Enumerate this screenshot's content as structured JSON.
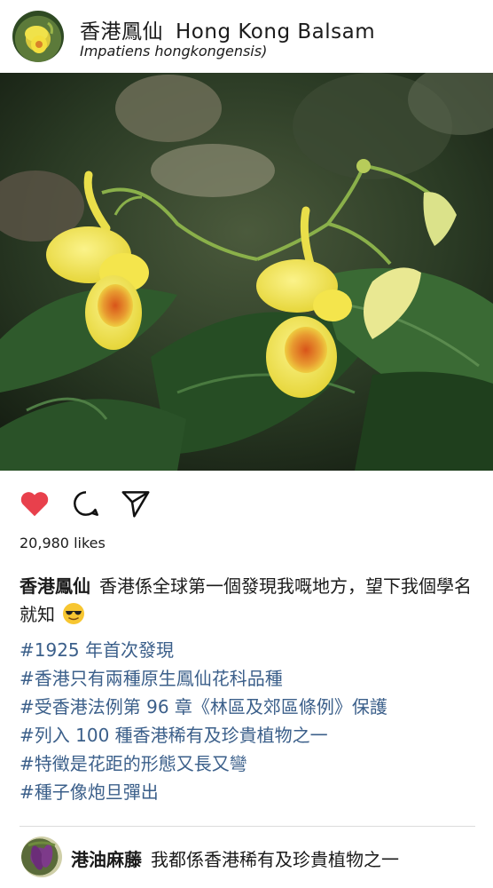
{
  "post": {
    "title_zh": "香港鳳仙",
    "title_en": "Hong Kong Balsam",
    "subtitle": "Impatiens hongkongensis)"
  },
  "actions": {
    "like_icon": "heart-icon",
    "comment_icon": "comment-bubble-icon",
    "share_icon": "paper-plane-icon",
    "like_color": "#e8404c"
  },
  "likes_text": "20,980 likes",
  "caption": {
    "username": "香港鳳仙",
    "text": "香港係全球第一個發現我嘅地方，望下我個學名就知",
    "emoji": "smiling-face-with-sunglasses-emoji"
  },
  "hashtags": [
    "#1925 年首次發現",
    "#香港只有兩種原生鳳仙花科品種",
    "#受香港法例第 96 章《林區及郊區條例》保護",
    "#列入 100 種香港稀有及珍貴植物之一",
    "#特徵是花距的形態又長又彎",
    "#種子像炮旦彈出"
  ],
  "comment": {
    "username": "港油麻藤",
    "text": "我都係香港稀有及珍貴植物之一"
  },
  "colors": {
    "hashtag": "#3b5f8a",
    "flower_yellow": "#f2e44a",
    "flower_orange": "#e07a1e",
    "leaf_green": "#2e5a2a"
  }
}
